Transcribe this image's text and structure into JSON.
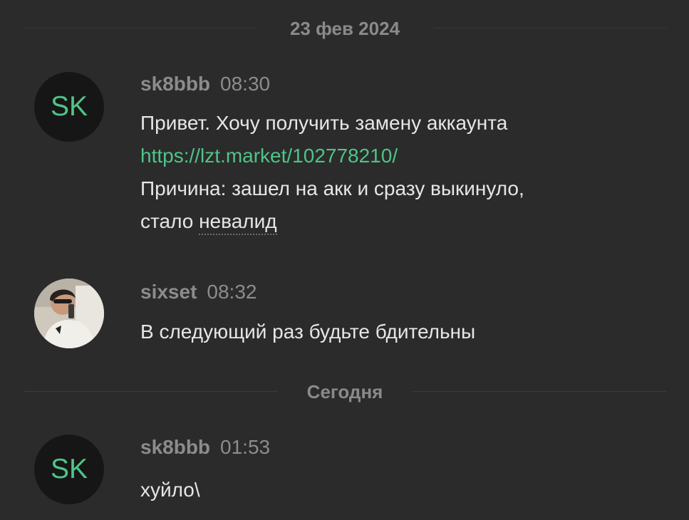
{
  "dividers": {
    "first": "23 фев 2024",
    "second": "Сегодня"
  },
  "messages": [
    {
      "avatar_text": "SK",
      "username": "sk8bbb",
      "time": "08:30",
      "line1": "Привет. Хочу получить замену аккаунта",
      "link": "https://lzt.market/102778210/",
      "line3": "Причина: зашел на акк и сразу выкинуло,",
      "line4_prefix": "стало ",
      "line4_word": "невалид"
    },
    {
      "avatar_icon": "user-photo",
      "username": "sixset",
      "time": "08:32",
      "text": "В следующий раз будьте бдительны"
    },
    {
      "avatar_text": "SK",
      "username": "sk8bbb",
      "time": "01:53",
      "text": "хуйло\\"
    }
  ],
  "colors": {
    "background": "#2b2b2b",
    "accent": "#4fc487",
    "muted": "#8c8c8c",
    "text": "#e6e6e6"
  }
}
